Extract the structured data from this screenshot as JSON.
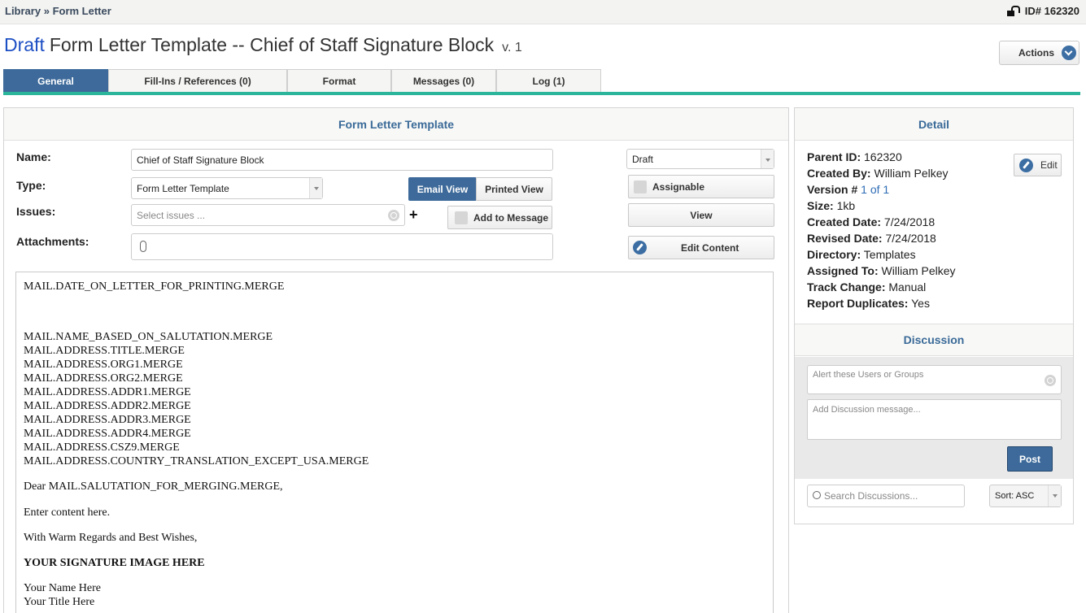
{
  "breadcrumb": {
    "library": "Library",
    "separator": "»",
    "current": "Form Letter"
  },
  "record_id": "ID# 162320",
  "title": {
    "status": "Draft",
    "main": "Form Letter Template --  Chief of Staff Signature Block",
    "version": "v. 1"
  },
  "actions_label": "Actions",
  "tabs": [
    {
      "label": "General",
      "active": true
    },
    {
      "label": "Fill-Ins / References (0)",
      "active": false
    },
    {
      "label": "Format",
      "active": false
    },
    {
      "label": "Messages (0)",
      "active": false
    },
    {
      "label": "Log (1)",
      "active": false
    }
  ],
  "form": {
    "panel_title": "Form Letter Template",
    "name_label": "Name:",
    "name_value": "Chief of Staff Signature Block",
    "type_label": "Type:",
    "type_value": "Form Letter Template",
    "issues_label": "Issues:",
    "issues_placeholder": "Select issues ...",
    "attachments_label": "Attachments:",
    "email_view": "Email View",
    "printed_view": "Printed View",
    "add_to_message": "Add to Message",
    "status_select": "Draft",
    "assignable": "Assignable",
    "view": "View",
    "edit_content": "Edit Content"
  },
  "content": {
    "line1": "MAIL.DATE_ON_LETTER_FOR_PRINTING.MERGE",
    "address": [
      "MAIL.NAME_BASED_ON_SALUTATION.MERGE",
      "MAIL.ADDRESS.TITLE.MERGE",
      "MAIL.ADDRESS.ORG1.MERGE",
      "MAIL.ADDRESS.ORG2.MERGE",
      "MAIL.ADDRESS.ADDR1.MERGE",
      "MAIL.ADDRESS.ADDR2.MERGE",
      "MAIL.ADDRESS.ADDR3.MERGE",
      "MAIL.ADDRESS.ADDR4.MERGE",
      "MAIL.ADDRESS.CSZ9.MERGE",
      "MAIL.ADDRESS.COUNTRY_TRANSLATION_EXCEPT_USA.MERGE"
    ],
    "salutation": "Dear MAIL.SALUTATION_FOR_MERGING.MERGE,",
    "body": "Enter content here.",
    "closing": "With Warm Regards and Best Wishes,",
    "signature": "YOUR SIGNATURE IMAGE HERE",
    "your_name": "Your Name Here",
    "your_title": "Your Title Here"
  },
  "detail": {
    "panel_title": "Detail",
    "edit_label": "Edit",
    "parent_id_label": "Parent ID:",
    "parent_id": "162320",
    "created_by_label": "Created By:",
    "created_by": "William Pelkey",
    "version_label": "Version #",
    "version_value": "1 of 1",
    "size_label": "Size:",
    "size": "1kb",
    "created_date_label": "Created Date:",
    "created_date": "7/24/2018",
    "revised_date_label": "Revised Date:",
    "revised_date": "7/24/2018",
    "directory_label": "Directory:",
    "directory": "Templates",
    "assigned_to_label": "Assigned To:",
    "assigned_to": "William Pelkey",
    "track_change_label": "Track Change:",
    "track_change": "Manual",
    "report_duplicates_label": "Report Duplicates:",
    "report_duplicates": "Yes"
  },
  "discussion": {
    "panel_title": "Discussion",
    "alert_placeholder": "Alert these Users or Groups",
    "message_placeholder": "Add Discussion message...",
    "post": "Post",
    "search_placeholder": "Search Discussions...",
    "sort": "Sort: ASC"
  },
  "colors": {
    "accent": "#3d6a9a",
    "tab_underline": "#2bb59a",
    "draft": "#1d4fc4",
    "link": "#2f6db5"
  }
}
